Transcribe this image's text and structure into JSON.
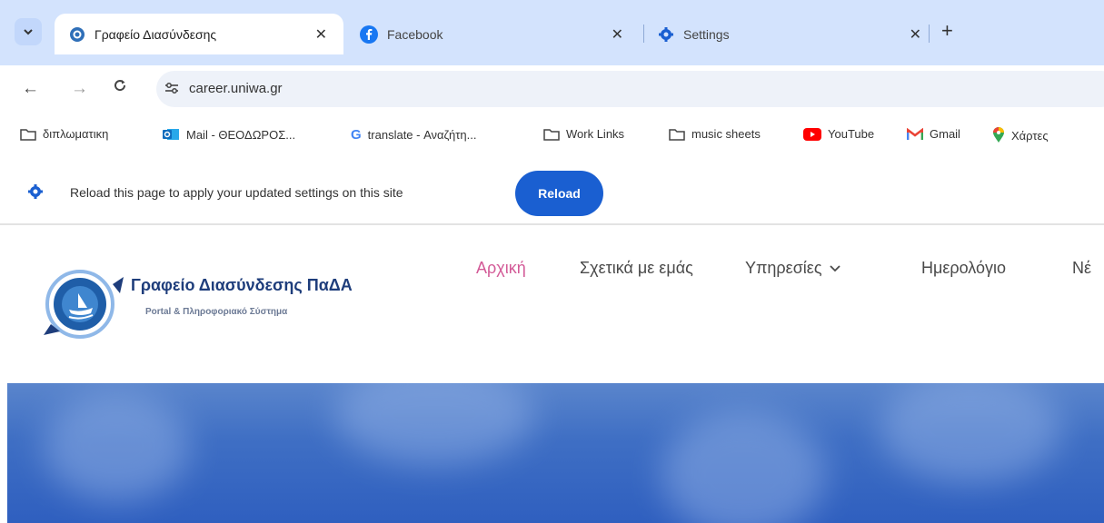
{
  "tabs": [
    {
      "title": "Γραφείο Διασύνδεσης",
      "active": true,
      "favicon": "site-icon"
    },
    {
      "title": "Facebook",
      "active": false,
      "favicon": "facebook-icon"
    },
    {
      "title": "Settings",
      "active": false,
      "favicon": "settings-gear-icon"
    }
  ],
  "address": {
    "url": "career.uniwa.gr"
  },
  "bookmarks": [
    {
      "label": "διπλωματικη",
      "icon": "folder-icon"
    },
    {
      "label": "Mail - ΘΕΟΔΩΡΟΣ...",
      "icon": "outlook-icon"
    },
    {
      "label": "translate - Αναζήτη...",
      "icon": "google-icon"
    },
    {
      "label": "Work Links",
      "icon": "folder-icon"
    },
    {
      "label": "music sheets",
      "icon": "folder-icon"
    },
    {
      "label": "YouTube",
      "icon": "youtube-icon"
    },
    {
      "label": "Gmail",
      "icon": "gmail-icon"
    },
    {
      "label": "Χάρτες",
      "icon": "maps-icon"
    }
  ],
  "infobar": {
    "message": "Reload this page to apply your updated settings on this site",
    "button": "Reload"
  },
  "site": {
    "title": "Γραφείο Διασύνδεσης ΠαΔΑ",
    "subtitle": "Portal & Πληροφοριακό Σύστημα",
    "menu": [
      {
        "label": "Αρχική",
        "active": true
      },
      {
        "label": "Σχετικά με εμάς",
        "active": false
      },
      {
        "label": "Υπηρεσίες",
        "active": false,
        "has_dropdown": true
      },
      {
        "label": "Ημερολόγιο",
        "active": false
      },
      {
        "label": "Νέ",
        "active": false
      }
    ]
  },
  "colors": {
    "accent": "#1a5fd1",
    "menu_active": "#d35a97",
    "tabbar": "#d3e3fd"
  }
}
